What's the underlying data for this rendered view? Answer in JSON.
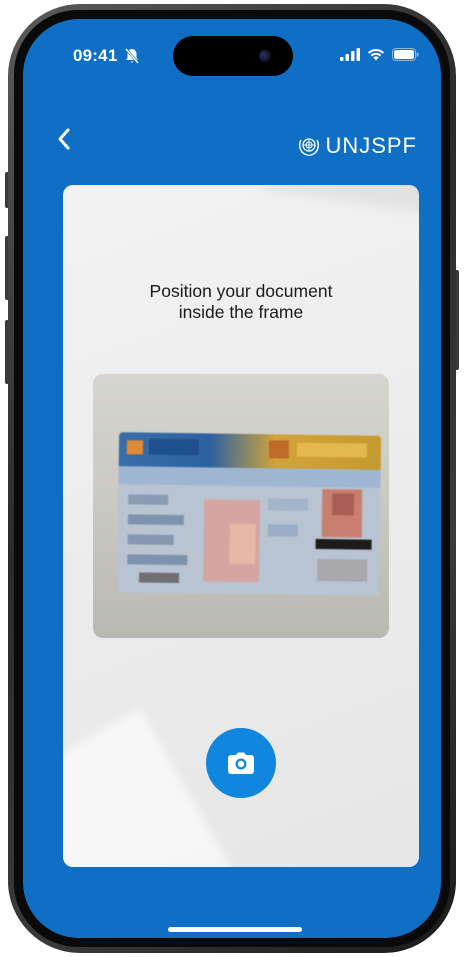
{
  "status_bar": {
    "time": "09:41",
    "icons": [
      "bell-off-icon",
      "signal-icon",
      "wifi-icon",
      "battery-icon"
    ]
  },
  "header": {
    "back_icon": "chevron-left-icon",
    "brand_text": "UNJSPF",
    "brand_icon": "un-emblem-icon"
  },
  "scanner": {
    "instruction_line1": "Position your document",
    "instruction_line2": "inside the frame",
    "capture_icon": "camera-icon"
  },
  "colors": {
    "primary": "#0e6fc4",
    "button": "#1186df",
    "card_bg": "#efefef"
  }
}
